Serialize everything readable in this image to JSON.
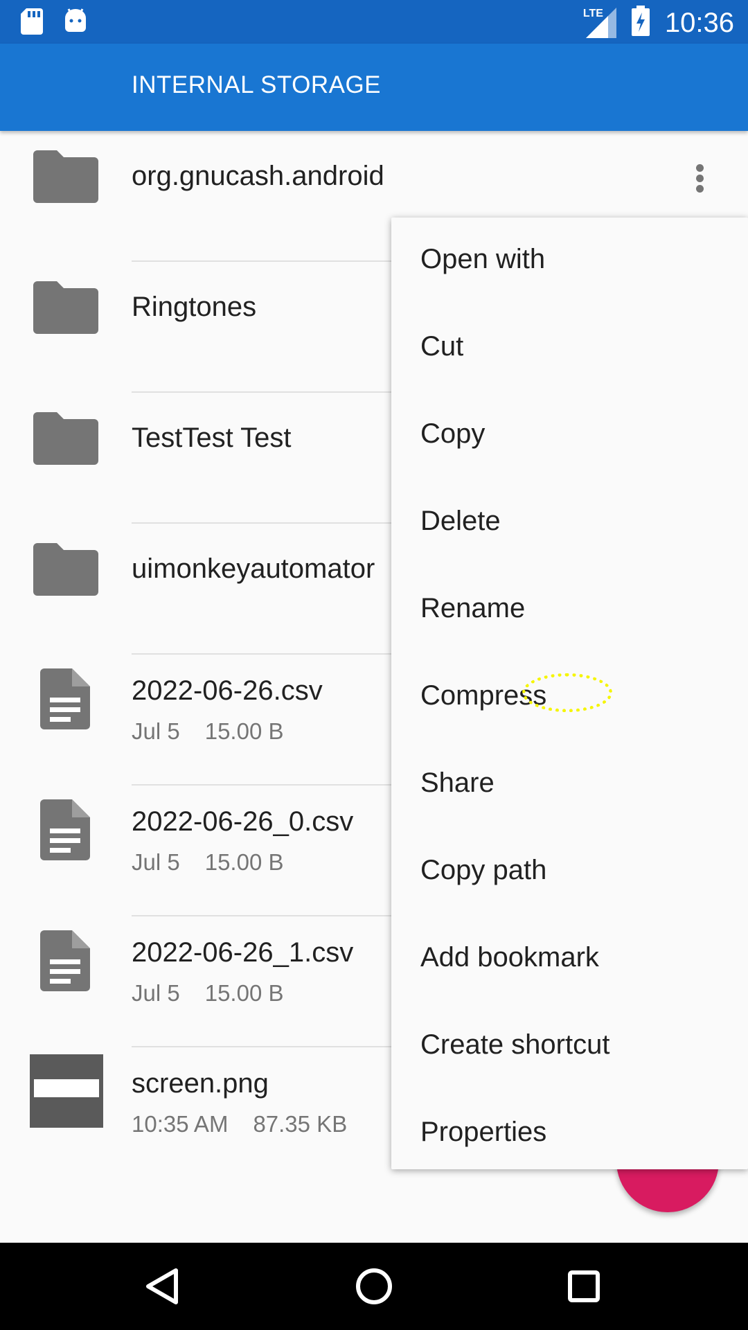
{
  "status_bar": {
    "time": "10:36",
    "network": "LTE",
    "icons": [
      "sd-card-icon",
      "android-icon",
      "lte-signal-icon",
      "battery-charging-icon"
    ]
  },
  "app_bar": {
    "title": "INTERNAL STORAGE"
  },
  "files": [
    {
      "name": "org.gnucash.android",
      "type": "folder"
    },
    {
      "name": "Ringtones",
      "type": "folder"
    },
    {
      "name": "TestTest Test",
      "type": "folder"
    },
    {
      "name": "uimonkeyautomator",
      "type": "folder"
    },
    {
      "name": "2022-06-26.csv",
      "type": "file",
      "date": "Jul 5",
      "size": "15.00 B"
    },
    {
      "name": "2022-06-26_0.csv",
      "type": "file",
      "date": "Jul 5",
      "size": "15.00 B"
    },
    {
      "name": "2022-06-26_1.csv",
      "type": "file",
      "date": "Jul 5",
      "size": "15.00 B"
    },
    {
      "name": "screen.png",
      "type": "image",
      "date": "10:35 AM",
      "size": "87.35 KB"
    }
  ],
  "context_menu": {
    "items": [
      "Open with",
      "Cut",
      "Copy",
      "Delete",
      "Rename",
      "Compress",
      "Share",
      "Copy path",
      "Add bookmark",
      "Create shortcut",
      "Properties"
    ]
  },
  "fab": {
    "icon": "plus-icon"
  },
  "colors": {
    "status_bar": "#1565c0",
    "app_bar": "#1976d2",
    "fab": "#d81b60",
    "icon_gray": "#757575"
  }
}
